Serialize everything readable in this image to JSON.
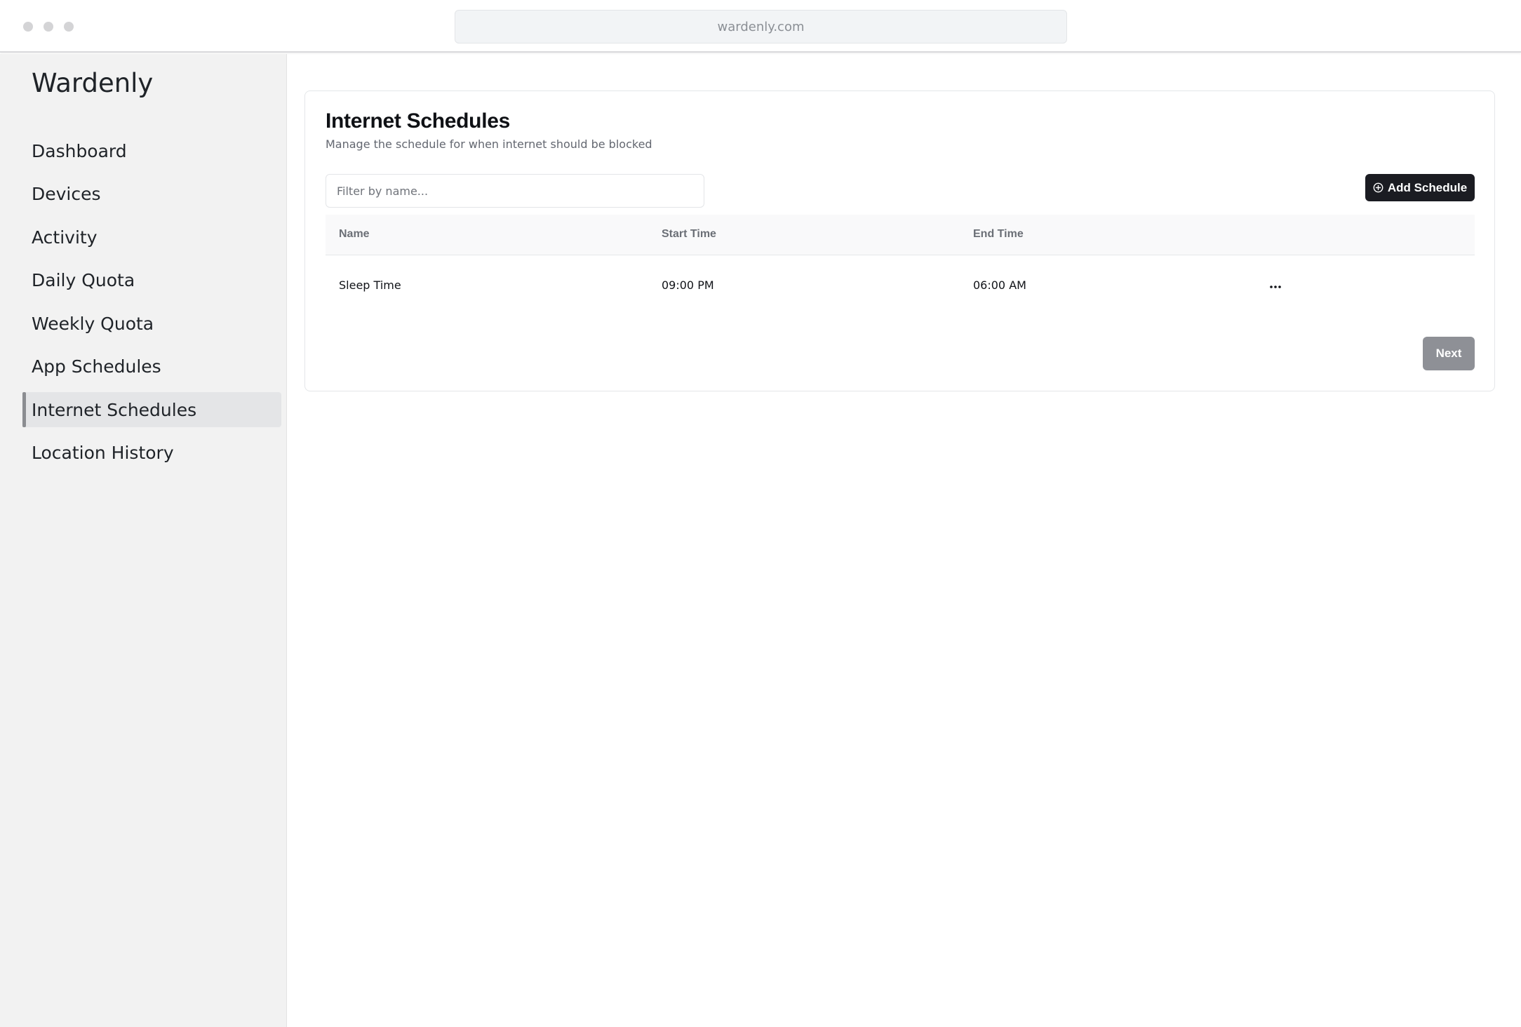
{
  "browser": {
    "url": "wardenly.com"
  },
  "sidebar": {
    "brand": "Wardenly",
    "items": [
      {
        "label": "Dashboard",
        "active": false
      },
      {
        "label": "Devices",
        "active": false
      },
      {
        "label": "Activity",
        "active": false
      },
      {
        "label": "Daily Quota",
        "active": false
      },
      {
        "label": "Weekly Quota",
        "active": false
      },
      {
        "label": "App Schedules",
        "active": false
      },
      {
        "label": "Internet Schedules",
        "active": true
      },
      {
        "label": "Location History",
        "active": false
      }
    ]
  },
  "main": {
    "title": "Internet Schedules",
    "subtitle": "Manage the schedule for when internet should be blocked",
    "filter": {
      "placeholder": "Filter by name...",
      "value": ""
    },
    "add_button": {
      "label": "Add Schedule",
      "icon": "plus-circle-icon"
    },
    "table": {
      "columns": [
        "Name",
        "Start Time",
        "End Time"
      ],
      "rows": [
        {
          "name": "Sleep Time",
          "start": "09:00 PM",
          "end": "06:00 AM",
          "actions_icon": "more-horizontal-icon"
        }
      ]
    },
    "pagination": {
      "next_label": "Next",
      "next_disabled": true
    }
  },
  "colors": {
    "primary_button": "#1b1c22",
    "disabled_button": "#8e9096",
    "sidebar_bg": "#f2f2f2",
    "active_nav_bg": "#e4e5e7"
  }
}
